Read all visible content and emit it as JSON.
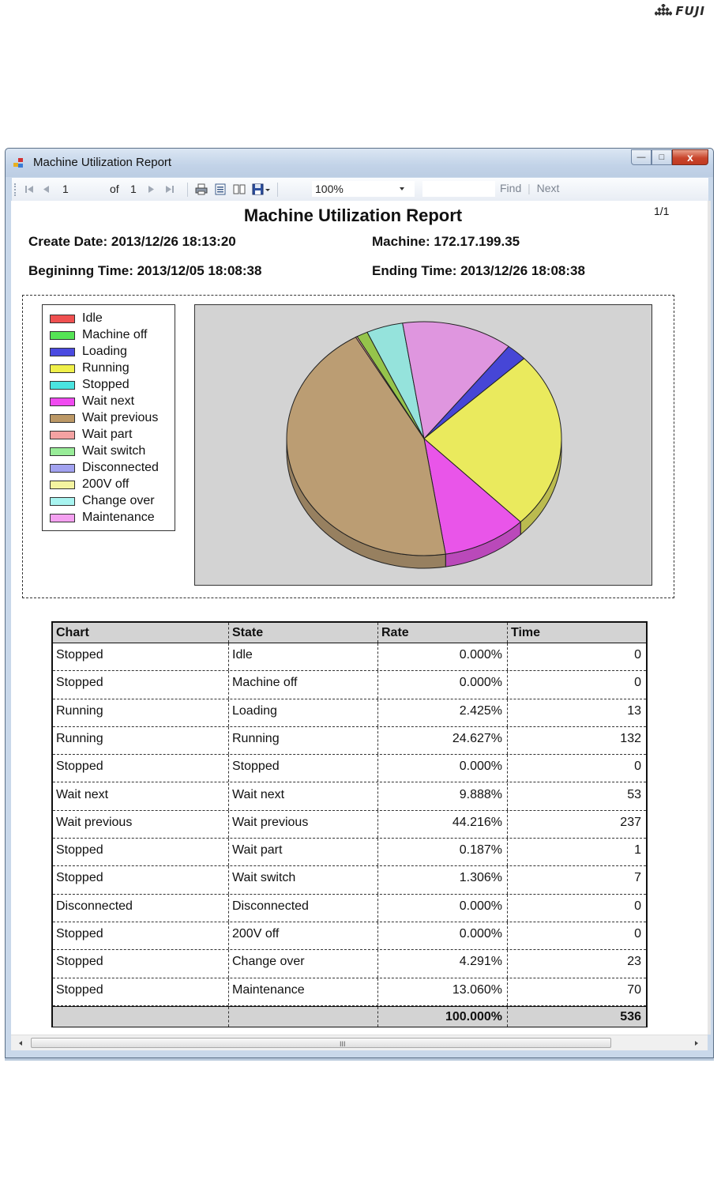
{
  "brand": {
    "name": "FUJI"
  },
  "window": {
    "title": "Machine Utilization Report",
    "close_symbol": "x",
    "max_symbol": "□",
    "min_symbol": "—"
  },
  "toolbar": {
    "current_page": "1",
    "of_label": "of",
    "total_pages": "1",
    "zoom": "100%",
    "find_label": "Find",
    "next_label": "Next",
    "separator": "|"
  },
  "report": {
    "page_indicator": "1/1",
    "title": "Machine Utilization Report",
    "create_date": "Create Date: 2013/12/26 18:13:20",
    "machine": "Machine: 172.17.199.35",
    "beginning_time": "Begininng Time: 2013/12/05 18:08:38",
    "ending_time": "Ending Time: 2013/12/26 18:08:38"
  },
  "legend": [
    {
      "label": "Idle",
      "color": "#ef5050"
    },
    {
      "label": "Machine off",
      "color": "#55e455"
    },
    {
      "label": "Loading",
      "color": "#4a4ae0"
    },
    {
      "label": "Running",
      "color": "#f0f04a"
    },
    {
      "label": "Stopped",
      "color": "#4ae4e0"
    },
    {
      "label": "Wait next",
      "color": "#f04af0"
    },
    {
      "label": "Wait previous",
      "color": "#bc9866"
    },
    {
      "label": "Wait part",
      "color": "#f4a2a2"
    },
    {
      "label": "Wait switch",
      "color": "#98ec98"
    },
    {
      "label": "Disconnected",
      "color": "#a2a2f0"
    },
    {
      "label": "200V off",
      "color": "#f4f4a0"
    },
    {
      "label": "Change over",
      "color": "#a8f4f0"
    },
    {
      "label": "Maintenance",
      "color": "#f4a0f0"
    }
  ],
  "chart_data": {
    "type": "pie",
    "slices": [
      {
        "label": "Idle",
        "value": 0.0,
        "color": "#ef5050"
      },
      {
        "label": "Machine off",
        "value": 0.0,
        "color": "#55e455"
      },
      {
        "label": "Loading",
        "value": 2.425,
        "color": "#3a3ad6"
      },
      {
        "label": "Running",
        "value": 24.627,
        "color": "#ecec52"
      },
      {
        "label": "Stopped",
        "value": 0.0,
        "color": "#4ae4e0"
      },
      {
        "label": "Wait next",
        "value": 9.888,
        "color": "#ea4aea"
      },
      {
        "label": "Wait previous",
        "value": 44.216,
        "color": "#b9986a"
      },
      {
        "label": "Wait part",
        "value": 0.187,
        "color": "#f4a2a2"
      },
      {
        "label": "Wait switch",
        "value": 1.306,
        "color": "#8fc23f"
      },
      {
        "label": "Disconnected",
        "value": 0.0,
        "color": "#a2a2f0"
      },
      {
        "label": "200V off",
        "value": 0.0,
        "color": "#f4f4a0"
      },
      {
        "label": "Change over",
        "value": 4.291,
        "color": "#8fe4dc"
      },
      {
        "label": "Maintenance",
        "value": 13.06,
        "color": "#e090e0"
      }
    ],
    "legend_position": "left",
    "style": "3d"
  },
  "table": {
    "headers": [
      "Chart",
      "State",
      "Rate",
      "Time"
    ],
    "rows": [
      {
        "chart": "Stopped",
        "state": "Idle",
        "rate": "0.000%",
        "time": "0"
      },
      {
        "chart": "Stopped",
        "state": "Machine off",
        "rate": "0.000%",
        "time": "0"
      },
      {
        "chart": "Running",
        "state": "Loading",
        "rate": "2.425%",
        "time": "13"
      },
      {
        "chart": "Running",
        "state": "Running",
        "rate": "24.627%",
        "time": "132"
      },
      {
        "chart": "Stopped",
        "state": "Stopped",
        "rate": "0.000%",
        "time": "0"
      },
      {
        "chart": "Wait next",
        "state": "Wait next",
        "rate": "9.888%",
        "time": "53"
      },
      {
        "chart": "Wait previous",
        "state": "Wait previous",
        "rate": "44.216%",
        "time": "237"
      },
      {
        "chart": "Stopped",
        "state": "Wait part",
        "rate": "0.187%",
        "time": "1"
      },
      {
        "chart": "Stopped",
        "state": "Wait switch",
        "rate": "1.306%",
        "time": "7"
      },
      {
        "chart": "Disconnected",
        "state": "Disconnected",
        "rate": "0.000%",
        "time": "0"
      },
      {
        "chart": "Stopped",
        "state": "200V off",
        "rate": "0.000%",
        "time": "0"
      },
      {
        "chart": "Stopped",
        "state": "Change over",
        "rate": "4.291%",
        "time": "23"
      },
      {
        "chart": "Stopped",
        "state": "Maintenance",
        "rate": "13.060%",
        "time": "70"
      }
    ],
    "total_rate": "100.000%",
    "total_time": "536"
  },
  "scrollbar": {
    "grip": "III"
  }
}
